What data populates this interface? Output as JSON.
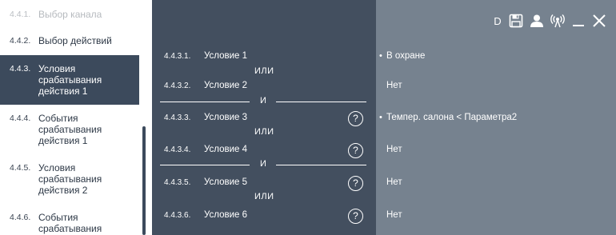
{
  "sidebar": {
    "items": [
      {
        "num": "4.4.1.",
        "label": "Выбор канала"
      },
      {
        "num": "4.4.2.",
        "label": "Выбор действий"
      },
      {
        "num": "4.4.3.",
        "label": "Условия срабатывания действия 1"
      },
      {
        "num": "4.4.4.",
        "label": "События срабатывания действия 1"
      },
      {
        "num": "4.4.5.",
        "label": "Условия срабатывания действия 2"
      },
      {
        "num": "4.4.6.",
        "label": "События срабатывания"
      }
    ]
  },
  "conditions": {
    "rows": [
      {
        "num": "4.4.3.1.",
        "name": "Условие 1"
      },
      {
        "num": "4.4.3.2.",
        "name": "Условие 2"
      },
      {
        "num": "4.4.3.3.",
        "name": "Условие 3",
        "help": "?"
      },
      {
        "num": "4.4.3.4.",
        "name": "Условие 4",
        "help": "?"
      },
      {
        "num": "4.4.3.5.",
        "name": "Условие 5",
        "help": "?"
      },
      {
        "num": "4.4.3.6.",
        "name": "Условие 6",
        "help": "?"
      }
    ],
    "or_label": "ИЛИ",
    "and_label": "И"
  },
  "values": {
    "rows": [
      {
        "text": "В охране",
        "bullet": "•"
      },
      {
        "text": "Нет"
      },
      {
        "text": "Темпер. салона < Параметра2",
        "bullet": "•"
      },
      {
        "text": "Нет"
      },
      {
        "text": "Нет"
      },
      {
        "text": "Нет"
      }
    ]
  },
  "toolbar": {
    "d_label": "D",
    "icons": [
      "save-icon",
      "user-icon",
      "antenna-icon",
      "minimize-icon",
      "close-icon"
    ]
  },
  "colors": {
    "sidebar_active": "#3c4a5c",
    "conditions_bg": "#434f5f",
    "values_bg": "#76828f"
  }
}
